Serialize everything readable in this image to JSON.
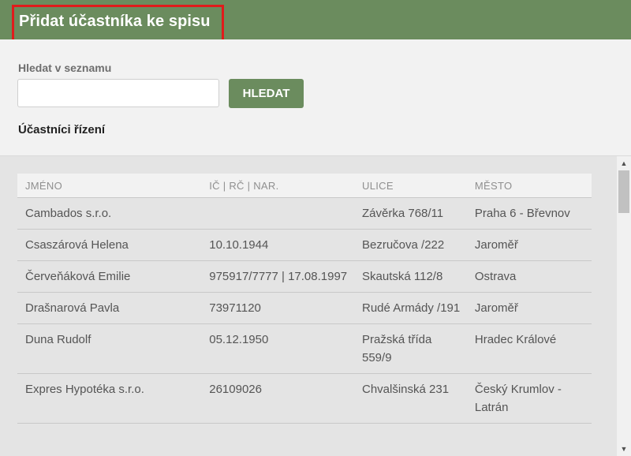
{
  "header": {
    "title": "Přidat účastníka ke spisu"
  },
  "search": {
    "label": "Hledat v seznamu",
    "value": "",
    "button_label": "HLEDAT"
  },
  "section": {
    "title": "Účastníci řízení"
  },
  "table": {
    "columns": {
      "name": "JMÉNO",
      "id": "IČ | RČ | NAR.",
      "street": "ULICE",
      "city": "MĚSTO"
    },
    "rows": [
      {
        "name": "Cambados s.r.o.",
        "id": "",
        "street": "Závěrka 768/11",
        "city": "Praha 6 - Břevnov"
      },
      {
        "name": "Csaszárová Helena",
        "id": "10.10.1944",
        "street": "Bezručova /222",
        "city": "Jaroměř"
      },
      {
        "name": "Červeňáková Emilie",
        "id": "975917/7777 | 17.08.1997",
        "street": "Skautská 112/8",
        "city": "Ostrava"
      },
      {
        "name": "Drašnarová Pavla",
        "id": "73971120",
        "street": "Rudé Armády /191",
        "city": "Jaroměř"
      },
      {
        "name": "Duna Rudolf",
        "id": "05.12.1950",
        "street": "Pražská třída 559/9",
        "city": "Hradec Králové"
      },
      {
        "name": "Expres Hypotéka s.r.o.",
        "id": "26109026",
        "street": "Chvalšinská 231",
        "city": "Český Krumlov - Latrán"
      }
    ]
  },
  "colors": {
    "header": "#6b8c5e",
    "highlight": "#e11b1b",
    "list_background": "#e4e4e4"
  },
  "icons": {
    "scroll_up": "arrow-up-icon",
    "scroll_down": "arrow-down-icon"
  }
}
